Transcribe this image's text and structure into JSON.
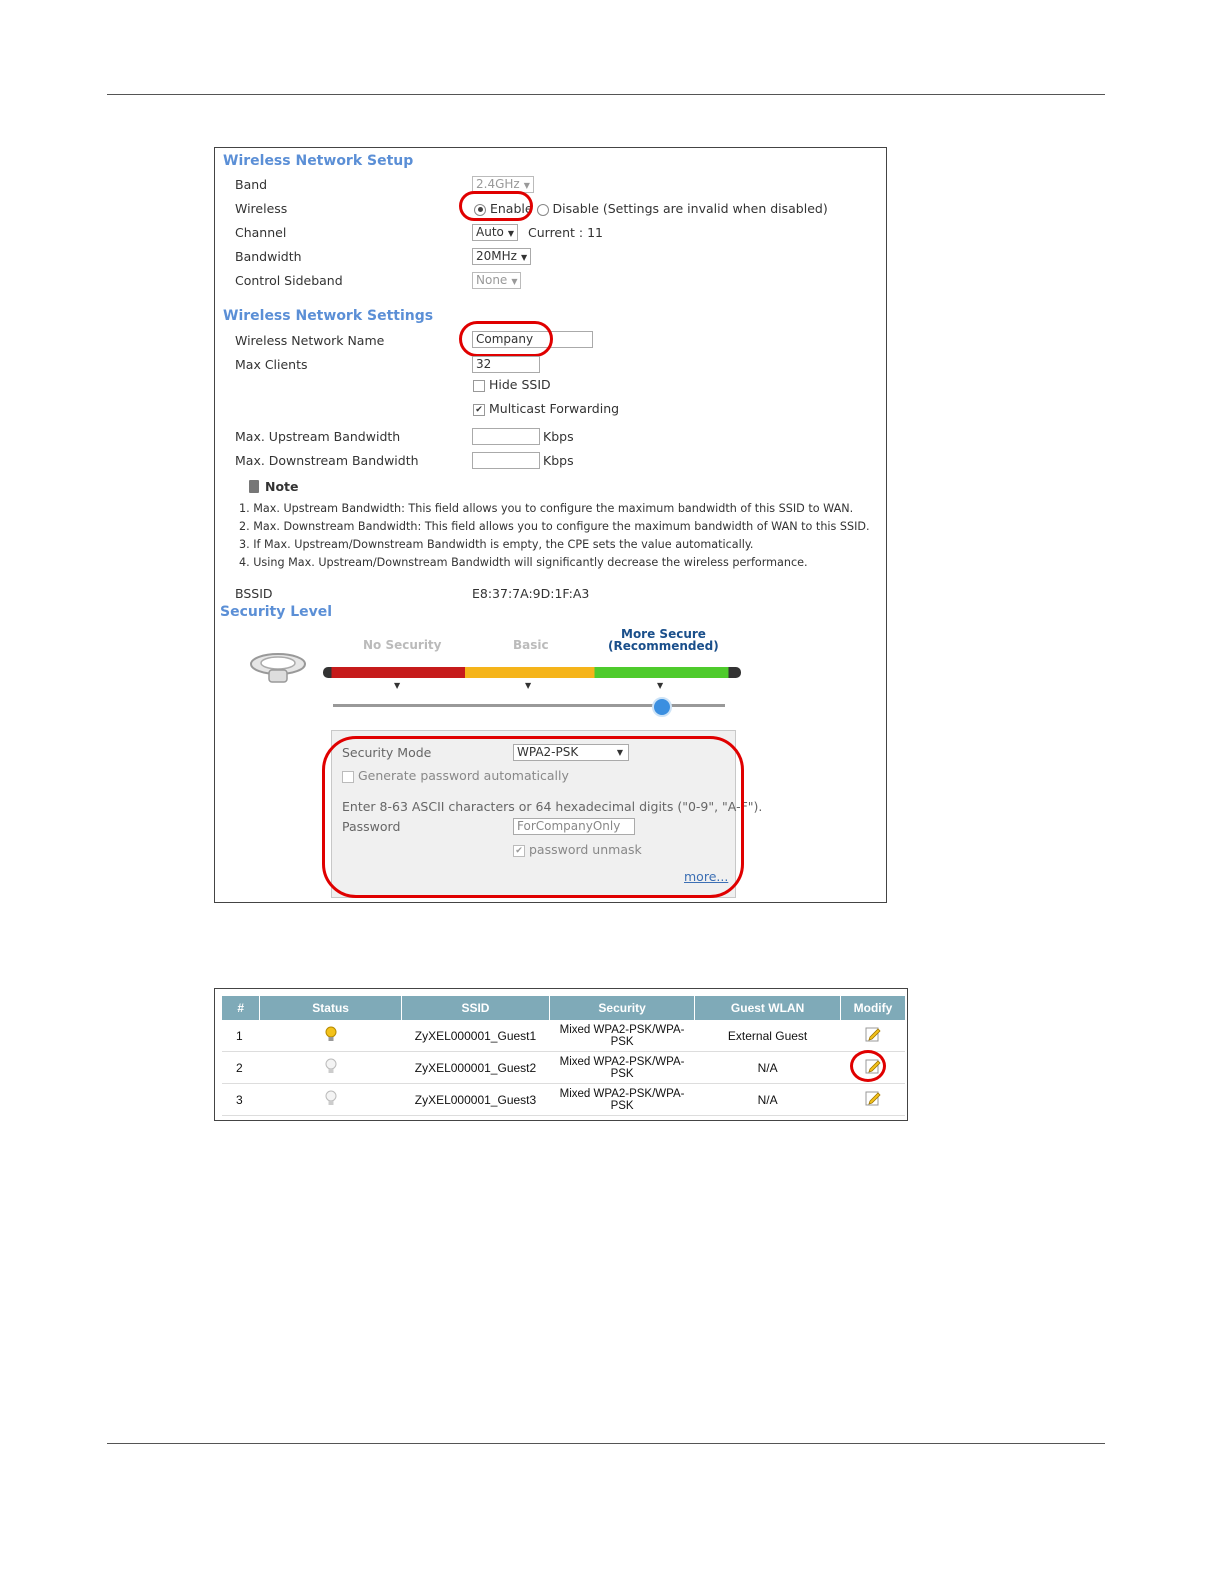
{
  "setup": {
    "title": "Wireless Network Setup",
    "band": {
      "label": "Band",
      "value": "2.4GHz"
    },
    "wireless": {
      "label": "Wireless",
      "enable": "Enable",
      "disable": "Disable (Settings are invalid when disabled)"
    },
    "channel": {
      "label": "Channel",
      "value": "Auto",
      "current": "Current : 11"
    },
    "bandwidth": {
      "label": "Bandwidth",
      "value": "20MHz"
    },
    "sideband": {
      "label": "Control Sideband",
      "value": "None"
    }
  },
  "settings": {
    "title": "Wireless Network Settings",
    "name": {
      "label": "Wireless Network Name",
      "value": "Company"
    },
    "max_clients": {
      "label": "Max Clients",
      "value": "32"
    },
    "hide_ssid": "Hide SSID",
    "multicast": "Multicast Forwarding",
    "upstream": {
      "label": "Max. Upstream Bandwidth",
      "unit": "Kbps"
    },
    "downstream": {
      "label": "Max. Downstream Bandwidth",
      "unit": "Kbps"
    },
    "note_title": "Note",
    "notes": [
      "1. Max. Upstream Bandwidth: This field allows you to configure the maximum bandwidth of this SSID to WAN.",
      "2. Max. Downstream Bandwidth: This field allows you to configure the maximum bandwidth of WAN to this SSID.",
      "3. If Max. Upstream/Downstream Bandwidth is empty, the CPE sets the value automatically.",
      "4. Using Max. Upstream/Downstream Bandwidth will significantly decrease the wireless performance."
    ],
    "bssid": {
      "label": "BSSID",
      "value": "E8:37:7A:9D:1F:A3"
    }
  },
  "security": {
    "title": "Security Level",
    "levels": [
      "No Security",
      "Basic",
      "More Secure",
      "(Recommended)"
    ],
    "mode": {
      "label": "Security Mode",
      "value": "WPA2-PSK"
    },
    "generate": "Generate password automatically",
    "hint": "Enter 8-63 ASCII characters or 64 hexadecimal digits (\"0-9\", \"A-F\").",
    "password": {
      "label": "Password",
      "value": "ForCompanyOnly"
    },
    "unmask": "password unmask",
    "more": "more..."
  },
  "colors": {
    "accent": "#5b8fd6",
    "highlight": "#e00000",
    "header": "#7faab8"
  },
  "table": {
    "headers": [
      "#",
      "Status",
      "SSID",
      "Security",
      "Guest WLAN",
      "Modify"
    ],
    "rows": [
      {
        "num": "1",
        "status_icon": "bulb-on-icon",
        "ssid": "ZyXEL000001_Guest1",
        "sec1": "Mixed WPA2-PSK/WPA-",
        "sec2": "PSK",
        "guest": "External Guest",
        "modify_icon": "edit-icon"
      },
      {
        "num": "2",
        "status_icon": "bulb-off-icon",
        "ssid": "ZyXEL000001_Guest2",
        "sec1": "Mixed WPA2-PSK/WPA-",
        "sec2": "PSK",
        "guest": "N/A",
        "modify_icon": "edit-icon"
      },
      {
        "num": "3",
        "status_icon": "bulb-off-icon",
        "ssid": "ZyXEL000001_Guest3",
        "sec1": "Mixed WPA2-PSK/WPA-",
        "sec2": "PSK",
        "guest": "N/A",
        "modify_icon": "edit-icon"
      }
    ]
  }
}
